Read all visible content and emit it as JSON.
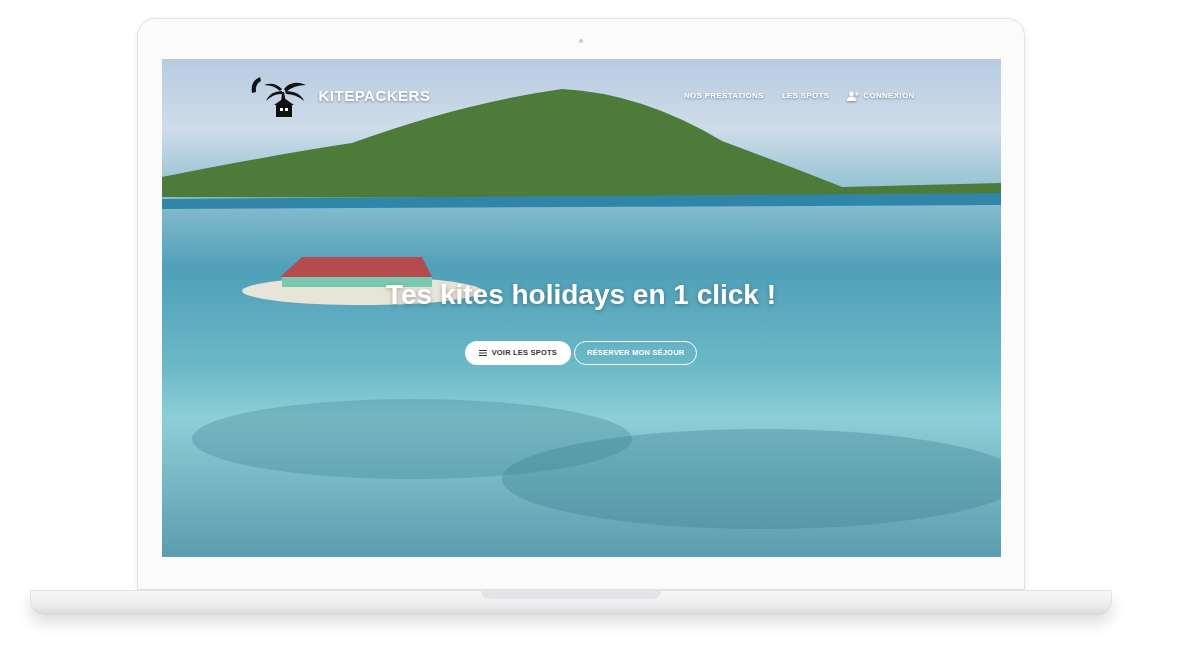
{
  "site": {
    "logo": "KITEPACKERS",
    "nav": [
      {
        "label": "NOS PRESTATIONS",
        "kind": "link"
      },
      {
        "label": "LES SPOTS",
        "kind": "link"
      },
      {
        "label": "CONNEXION",
        "kind": "account"
      }
    ]
  },
  "hero": {
    "title": "Tes kites holidays en 1 click !",
    "buttons": [
      {
        "label": "VOIR LES SPOTS",
        "kind": "filled"
      },
      {
        "label": "RÉSERVER MON SÉJOUR",
        "kind": "outline"
      }
    ]
  }
}
